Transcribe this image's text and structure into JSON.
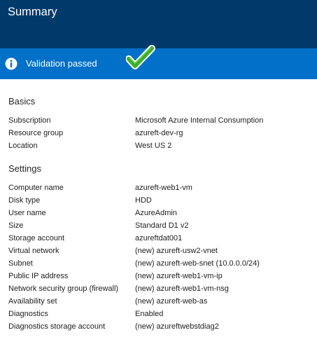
{
  "header": {
    "title": "Summary"
  },
  "banner": {
    "text": "Validation passed",
    "icon": "info-icon",
    "status_icon": "checkmark-icon",
    "colors": {
      "header": "#003a6b",
      "banner": "#0070c9",
      "check": "#3fae29"
    }
  },
  "basics": {
    "title": "Basics",
    "rows": [
      {
        "label": "Subscription",
        "value": "Microsoft Azure Internal Consumption"
      },
      {
        "label": "Resource group",
        "value": "azureft-dev-rg"
      },
      {
        "label": "Location",
        "value": "West US 2"
      }
    ]
  },
  "settings": {
    "title": "Settings",
    "rows": [
      {
        "label": "Computer name",
        "value": "azureft-web1-vm"
      },
      {
        "label": "Disk type",
        "value": "HDD"
      },
      {
        "label": "User name",
        "value": "AzureAdmin"
      },
      {
        "label": "Size",
        "value": "Standard D1 v2"
      },
      {
        "label": "Storage account",
        "value": "azureftdat001"
      },
      {
        "label": "Virtual network",
        "value": "(new) azureft-usw2-vnet"
      },
      {
        "label": "Subnet",
        "value": "(new) azureft-web-snet (10.0.0.0/24)"
      },
      {
        "label": "Public IP address",
        "value": "(new) azureft-web1-vm-ip"
      },
      {
        "label": "Network security group (firewall)",
        "value": "(new) azureft-web1-vm-nsg"
      },
      {
        "label": "Availability set",
        "value": "(new) azureft-web-as"
      },
      {
        "label": "Diagnostics",
        "value": "Enabled"
      },
      {
        "label": "Diagnostics storage account",
        "value": "(new) azureftwebstdiag2"
      }
    ]
  }
}
